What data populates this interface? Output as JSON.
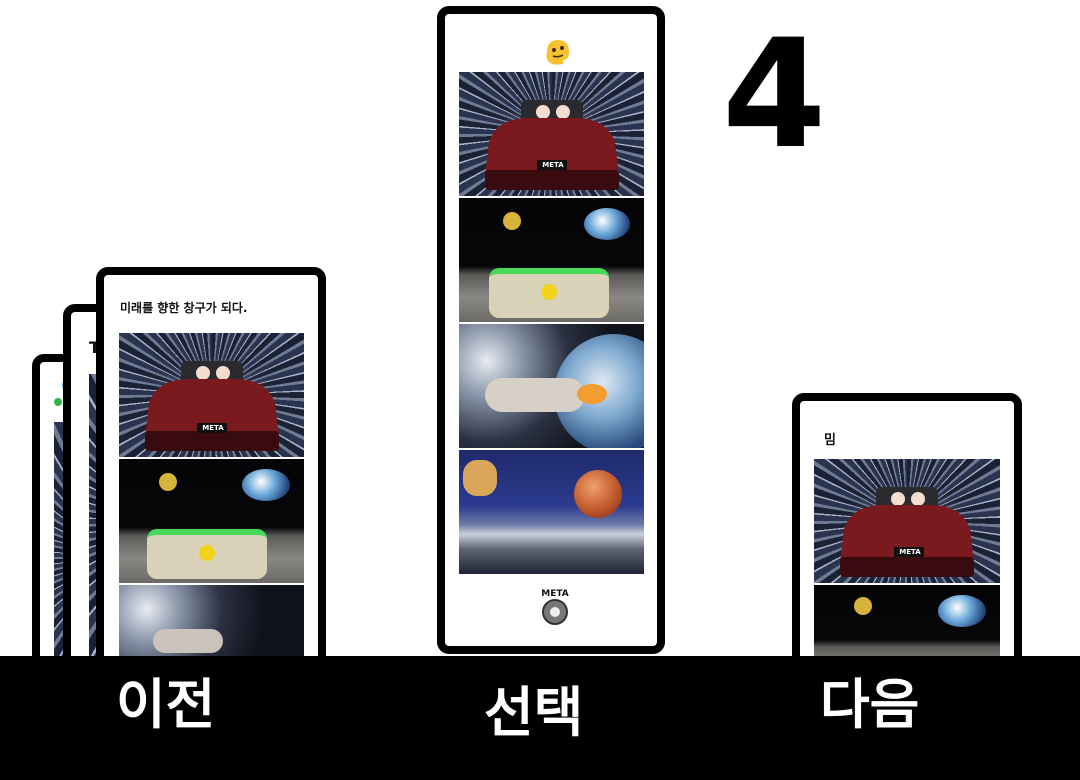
{
  "counter": "4",
  "selected_card": {
    "icon": "melting-face-emoji",
    "footer_logo": "META gear logo",
    "plate_text": "META"
  },
  "prev_stack": {
    "front_title": "미래를 향한 창구가 되다.",
    "middle_title_partial": "Th",
    "plate_text": "META"
  },
  "next_card": {
    "title": "밈",
    "plate_text": "META"
  },
  "nav": {
    "prev_label": "이전",
    "select_label": "선택",
    "next_label": "다음"
  },
  "colors": {
    "background": "#ffffff",
    "frame": "#000000",
    "car_red": "#7a1a1f",
    "bar": "#000000"
  }
}
